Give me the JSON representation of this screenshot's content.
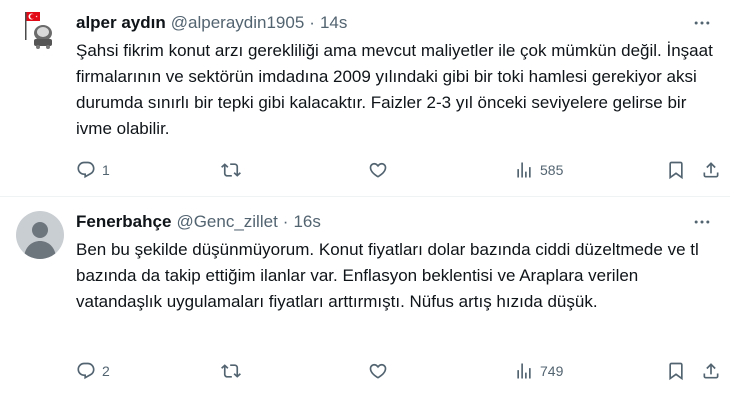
{
  "tweets": [
    {
      "display_name": "alper aydın",
      "handle": "@alperaydin1905",
      "separator": "·",
      "time": "14s",
      "text": "Şahsi fikrim konut arzı gerekliliği ama mevcut maliyetler ile çok mümkün değil. İnşaat firmalarının ve sektörün imdadına 2009 yılındaki gibi bir toki hamlesi gerekiyor aksi durumda sınırlı bir tepki gibi kalacaktır. Faizler 2-3 yıl önceki seviyelere gelirse bir ivme olabilir.",
      "reply_count": "1",
      "retweet_count": "",
      "like_count": "",
      "view_count": "585",
      "avatar_icon": "flag-crest-avatar"
    },
    {
      "display_name": "Fenerbahçe",
      "handle": "@Genc_zillet",
      "separator": "·",
      "time": "16s",
      "text": "Ben bu şekilde düşünmüyorum. Konut fiyatları dolar bazında ciddi düzeltmede ve tl bazında da takip ettiğim ilanlar var. Enflasyon beklentisi ve Araplara verilen vatandaşlık uygulamaları fiyatları arttırmıştı. Nüfus artış hızıda düşük.",
      "reply_count": "2",
      "retweet_count": "",
      "like_count": "",
      "view_count": "749",
      "avatar_icon": "default-user-avatar"
    }
  ],
  "colors": {
    "text_primary": "#0f1419",
    "text_secondary": "#536471",
    "divider": "#eff3f4",
    "flag_red": "#e30a17",
    "default_avatar_bg": "#c9ced3"
  }
}
